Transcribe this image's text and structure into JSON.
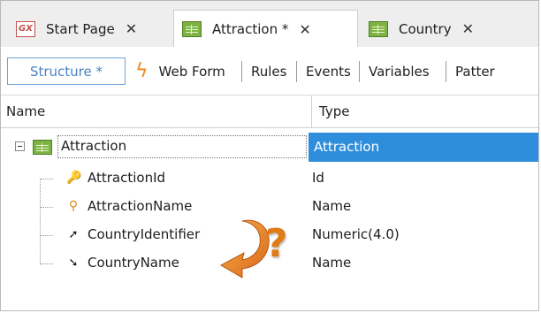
{
  "tabs": [
    {
      "label": "Start Page",
      "icon": "genexus-gx-icon",
      "close": "✕"
    },
    {
      "label": "Attraction *",
      "icon": "transaction-table-icon",
      "close": "✕"
    },
    {
      "label": "Country",
      "icon": "transaction-table-icon",
      "close": "✕"
    }
  ],
  "toolbar": {
    "structure": "Structure *",
    "web_form": "Web Form",
    "rules": "Rules",
    "events": "Events",
    "variables": "Variables",
    "patterns": "Patter"
  },
  "grid": {
    "col_name": "Name",
    "col_type": "Type",
    "root": {
      "name": "Attraction",
      "type": "Attraction"
    },
    "attributes": [
      {
        "name": "AttractionId",
        "type": "Id",
        "icon": "key-icon"
      },
      {
        "name": "AttractionName",
        "type": "Name",
        "icon": "magnifier-icon"
      },
      {
        "name": "CountryIdentifier",
        "type": "Numeric(4.0)",
        "icon": "foreign-key-arrow-icon"
      },
      {
        "name": "CountryName",
        "type": "Name",
        "icon": "inferred-arrow-icon"
      }
    ]
  },
  "annotation": {
    "question_mark": "?"
  },
  "colors": {
    "selection": "#2f8edb",
    "accent_orange": "#f08a1e",
    "structure_blue": "#4b82c3"
  }
}
